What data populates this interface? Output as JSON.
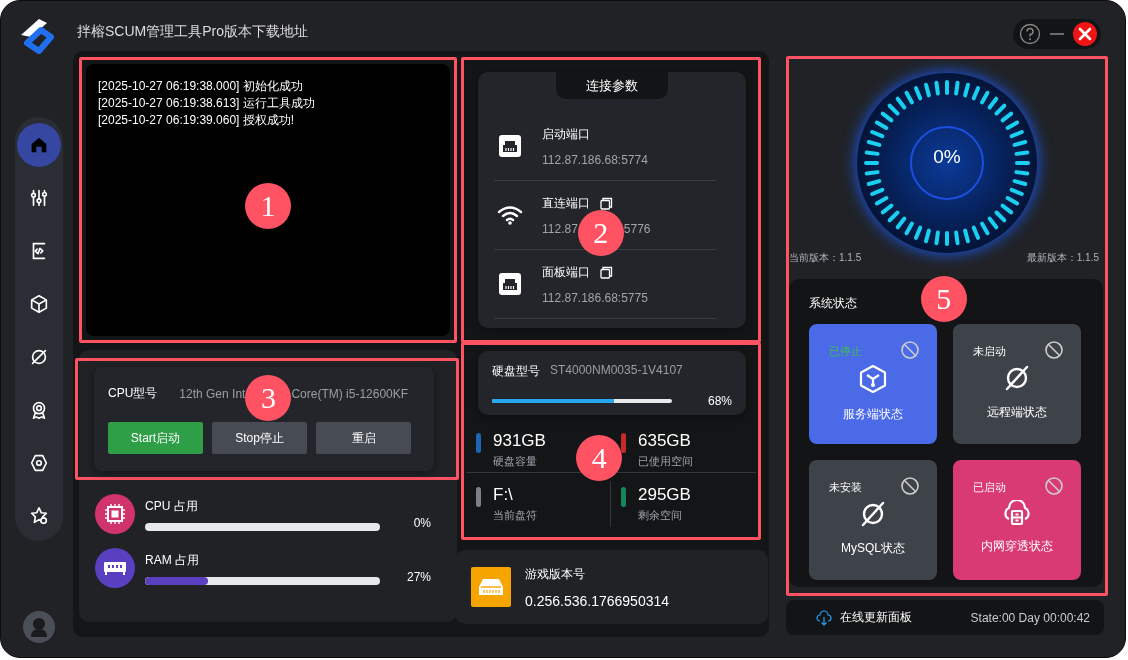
{
  "window": {
    "title": "拌榕SCUM管理工具Pro版本下载地址"
  },
  "nav": [
    {
      "selected": true
    },
    {
      "selected": false
    },
    {
      "selected": false
    },
    {
      "selected": false
    },
    {
      "selected": false
    },
    {
      "selected": false
    },
    {
      "selected": false
    },
    {
      "selected": false
    }
  ],
  "annotations": [
    {
      "number": "1"
    },
    {
      "number": "2"
    },
    {
      "number": "3"
    },
    {
      "number": "4"
    },
    {
      "number": "5"
    }
  ],
  "log": [
    "[2025-10-27 06:19:38.000] 初始化成功",
    "[2025-10-27 06:19:38.613] 运行工具成功",
    "[2025-10-27 06:19:39.060] 授权成功!"
  ],
  "cpu": {
    "label": "CPU型号",
    "value_parts": [
      "12th Gen Int",
      "Core(TM) i5-12600KF"
    ],
    "buttons": [
      {
        "label": "Start启动",
        "kind": "primary"
      },
      {
        "label": "Stop停止",
        "kind": "secondary"
      },
      {
        "label": "重启",
        "kind": "secondary"
      }
    ]
  },
  "usage": [
    {
      "kind": "cpu",
      "label": "CPU 占用",
      "level": 0,
      "reading": "0%"
    },
    {
      "kind": "ram",
      "label": "RAM 占用",
      "level": 0.27,
      "reading": "27%"
    }
  ],
  "connection": {
    "title": "连接参数",
    "rows": [
      {
        "kind": "ethernet",
        "label": "启动端口",
        "copyable": false,
        "value_parts": [
          "112.87.186.68:5774"
        ]
      },
      {
        "kind": "wifi",
        "label": "直连端口",
        "copyable": true,
        "value_parts": [
          "112.87",
          "5776"
        ]
      },
      {
        "kind": "ethernet",
        "label": "面板端口",
        "copyable": true,
        "value_parts": [
          "112.87.186.68:5775"
        ]
      }
    ]
  },
  "disk": {
    "label": "硬盘型号",
    "model": "ST4000NM0035-1V4107",
    "level": 0.68,
    "reading": "68%",
    "stats": [
      {
        "value": "931GB",
        "label": "硬盘容量",
        "color": "#1e64b4"
      },
      {
        "value": "635GB",
        "label": "已使用空间",
        "color": "#c62a2a"
      },
      {
        "value": "F:\\",
        "label": "当前盘符",
        "color": "#7c8088"
      },
      {
        "value": "295GB",
        "label": "剩余空间",
        "color": "#13875a"
      }
    ]
  },
  "game_version": {
    "label": "游戏版本号",
    "value": "0.256.536.1766950314"
  },
  "gauge": {
    "reading": "0%",
    "current_version": "当前版本：1.1.5",
    "latest_version": "最新版本：1.1.5"
  },
  "system_status": {
    "title": "系统状态",
    "tiles": [
      {
        "kind": "server",
        "color": "#4a6ae8",
        "status": {
          "text": "已停止",
          "highlighted": true
        },
        "label": "服务端状态"
      },
      {
        "kind": "remote",
        "color": "#3e4249",
        "status": {
          "text": "未启动",
          "highlighted": false
        },
        "label": "远程端状态"
      },
      {
        "kind": "database",
        "color": "#3e4249",
        "status": {
          "text": "未安装",
          "highlighted": false
        },
        "label": "MySQL状态"
      },
      {
        "kind": "tunnel",
        "color": "#d93a72",
        "status": {
          "text": "已启动",
          "highlighted": false
        },
        "label": "内网穿透状态"
      }
    ]
  },
  "footer": {
    "update_button": "在线更新面板",
    "uptime": "State:00 Day 00:00:42"
  }
}
